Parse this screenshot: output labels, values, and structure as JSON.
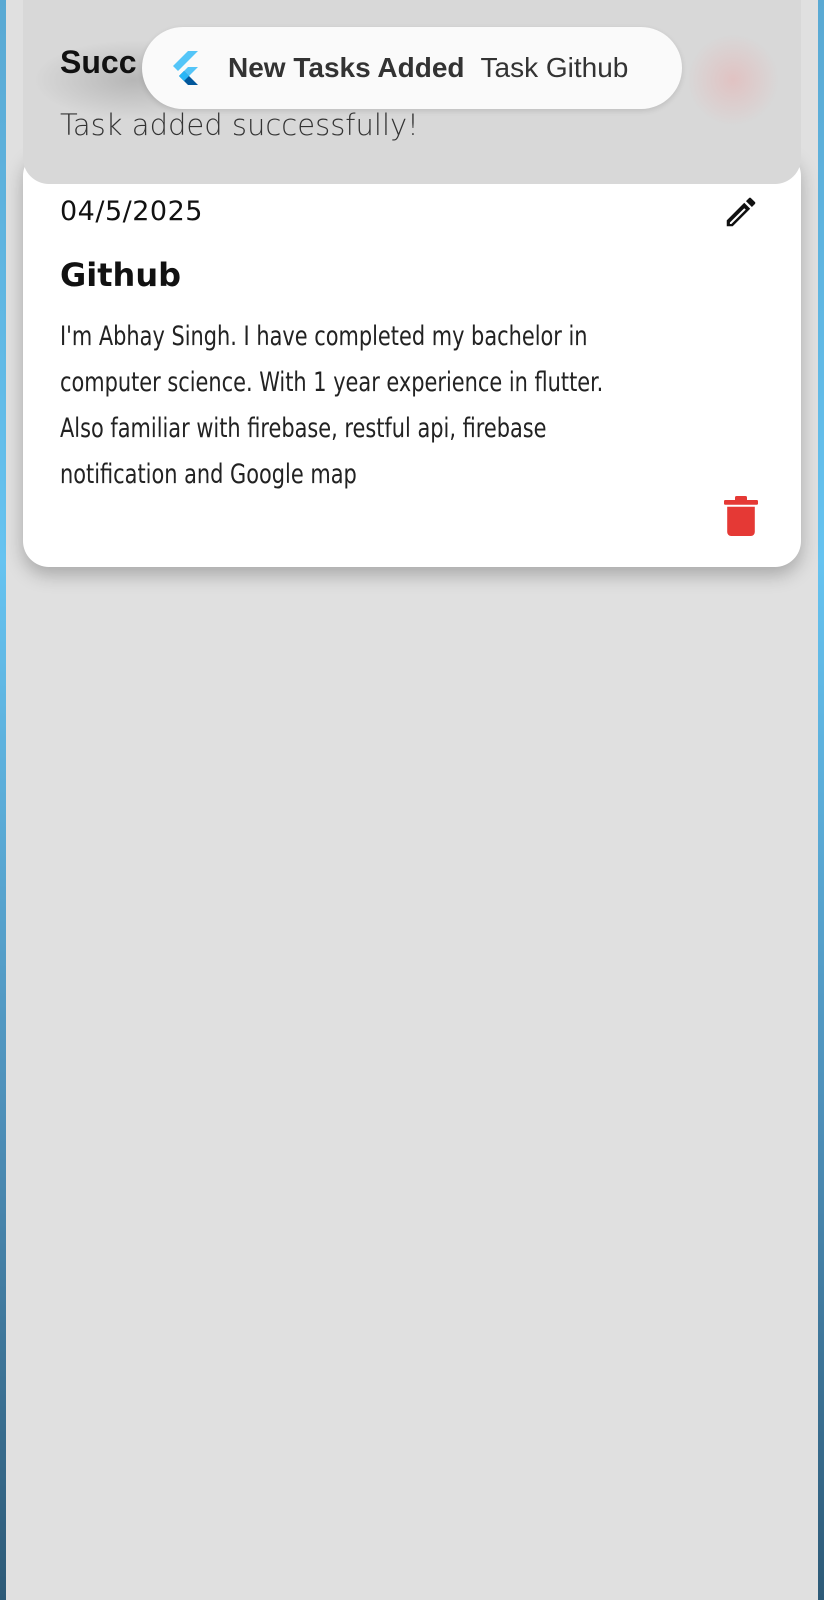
{
  "notification": {
    "app_icon": "flutter-logo",
    "title": "New Tasks Added",
    "body": "Task Github"
  },
  "snackbar": {
    "title": "Succ",
    "message": "Task added successfully!"
  },
  "task": {
    "date": "04/5/2025",
    "title": "Github",
    "description_lines": [
      "I'm Abhay Singh. I have completed my bachelor in",
      "computer science.  With 1 year experience in flutter.",
      "Also familiar with firebase, restful api,  firebase",
      "notification and Google map"
    ],
    "edit_icon": "pencil-icon",
    "delete_icon": "trash-icon"
  },
  "colors": {
    "background": "#e0e0e0",
    "card": "#ffffff",
    "delete": "#e53935",
    "accent_edge": "#66c3f0"
  }
}
